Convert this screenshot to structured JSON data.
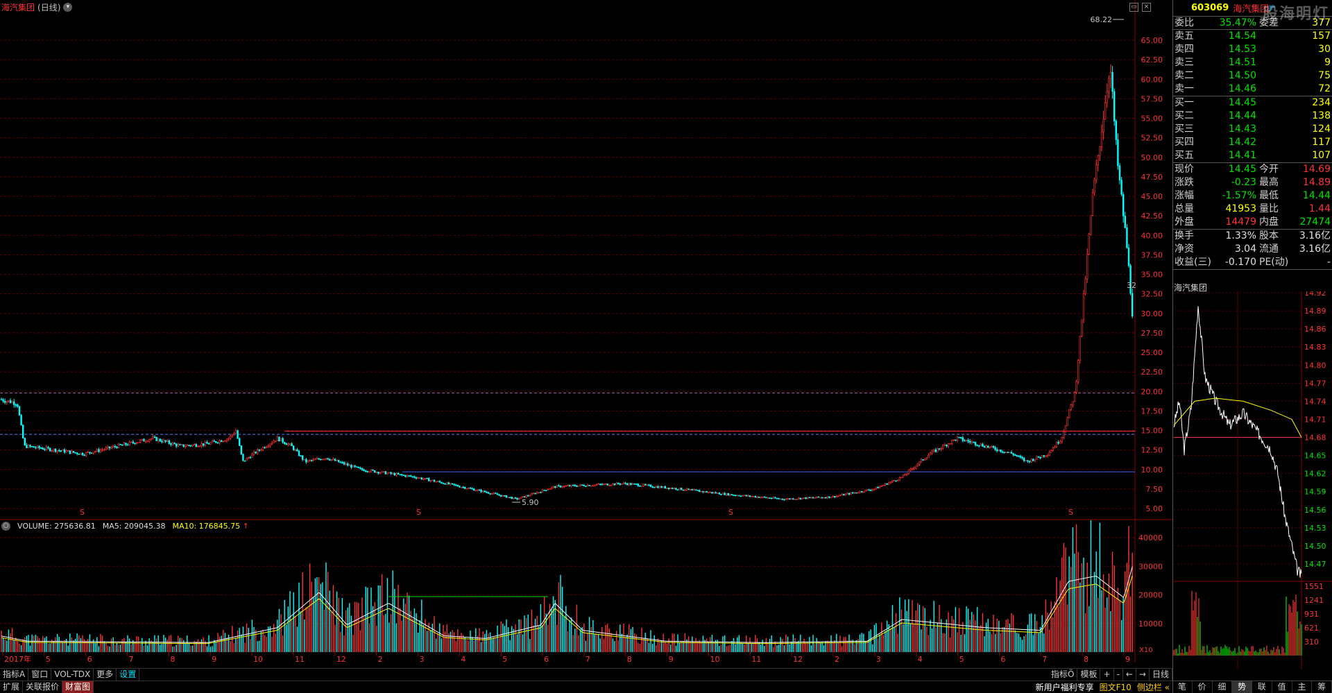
{
  "chart_title": {
    "name": "海汽集团",
    "period": "(日线)"
  },
  "kline": {
    "price_axis": [
      "65.00",
      "62.50",
      "60.00",
      "57.50",
      "55.00",
      "52.50",
      "50.00",
      "47.50",
      "45.00",
      "42.50",
      "40.00",
      "37.50",
      "35.00",
      "32.50",
      "30.00",
      "27.50",
      "25.00",
      "22.50",
      "20.00",
      "17.50",
      "15.00",
      "12.50",
      "10.00",
      "7.50",
      "5.00"
    ],
    "high_label": "68.22",
    "low_label": "5.90",
    "side_label": "32"
  },
  "volume": {
    "vol_label": "VOLUME: 275636.81",
    "ma5_label": "MA5: 209045.38",
    "ma10_label": "MA10: 176845.75",
    "arrow": "↑",
    "axis": [
      "40000",
      "30000",
      "20000",
      "10000"
    ],
    "unit": "X10"
  },
  "time_axis": [
    "2017年",
    "5",
    "6",
    "7",
    "8",
    "9",
    "10",
    "11",
    "12",
    "2",
    "3",
    "4",
    "5",
    "6",
    "7",
    "8",
    "9",
    "10",
    "11",
    "12",
    "2",
    "3",
    "4",
    "5",
    "6",
    "7",
    "8",
    "9"
  ],
  "bottom": {
    "row1": [
      "指标A",
      "窗口",
      "VOL-TDX",
      "更多",
      "设置"
    ],
    "row2": [
      "扩展",
      "关联报价",
      "财富图"
    ],
    "right_tabs": [
      "指标Ö",
      "模板"
    ],
    "nav": [
      "+",
      "-",
      "←",
      "→"
    ],
    "period_btn": "日线",
    "promo": "新用户福利专享",
    "f10": "图文F10",
    "side": "侧边栏"
  },
  "panel": {
    "code": "603069",
    "name": "海汽集团",
    "watermark": "股海明灯",
    "weibi_label": "委比",
    "weibi": "35.47%",
    "weicha_label": "委差",
    "weicha": "377",
    "sells": [
      {
        "label": "卖五",
        "price": "14.54",
        "vol": "157"
      },
      {
        "label": "卖四",
        "price": "14.53",
        "vol": "30"
      },
      {
        "label": "卖三",
        "price": "14.51",
        "vol": "9"
      },
      {
        "label": "卖二",
        "price": "14.50",
        "vol": "75"
      },
      {
        "label": "卖一",
        "price": "14.46",
        "vol": "72"
      }
    ],
    "buys": [
      {
        "label": "买一",
        "price": "14.45",
        "vol": "234"
      },
      {
        "label": "买二",
        "price": "14.44",
        "vol": "138"
      },
      {
        "label": "买三",
        "price": "14.43",
        "vol": "124"
      },
      {
        "label": "买四",
        "price": "14.42",
        "vol": "117"
      },
      {
        "label": "买五",
        "price": "14.41",
        "vol": "107"
      }
    ],
    "stats": [
      {
        "l1": "现价",
        "v1": "14.45",
        "c1": "green",
        "l2": "今开",
        "v2": "14.69",
        "c2": "red"
      },
      {
        "l1": "涨跌",
        "v1": "-0.23",
        "c1": "green",
        "l2": "最高",
        "v2": "14.89",
        "c2": "red"
      },
      {
        "l1": "涨幅",
        "v1": "-1.57%",
        "c1": "green",
        "l2": "最低",
        "v2": "14.44",
        "c2": "green"
      },
      {
        "l1": "总量",
        "v1": "41953",
        "c1": "yellow",
        "l2": "量比",
        "v2": "1.44",
        "c2": "red"
      },
      {
        "l1": "外盘",
        "v1": "14479",
        "c1": "red",
        "l2": "内盘",
        "v2": "27474",
        "c2": "green"
      }
    ],
    "stats2": [
      {
        "l1": "换手",
        "v1": "1.33%",
        "l2": "股本",
        "v2": "3.16亿"
      },
      {
        "l1": "净资",
        "v1": "3.04",
        "l2": "流通",
        "v2": "3.16亿"
      },
      {
        "l1": "收益(三)",
        "v1": "-0.170",
        "l2": "PE(动)",
        "v2": "-"
      }
    ],
    "intraday_title": "海汽集团",
    "intraday_axis": [
      "14.92",
      "14.89",
      "14.86",
      "14.83",
      "14.80",
      "14.77",
      "14.74",
      "14.71",
      "14.68",
      "14.65",
      "14.62",
      "14.59",
      "14.56",
      "14.53",
      "14.50",
      "14.47"
    ],
    "intraday_vol_axis": [
      "1551",
      "1241",
      "931",
      "621",
      "310"
    ],
    "tabs": [
      "笔",
      "价",
      "细",
      "势",
      "联",
      "值",
      "主",
      "筹"
    ]
  }
}
